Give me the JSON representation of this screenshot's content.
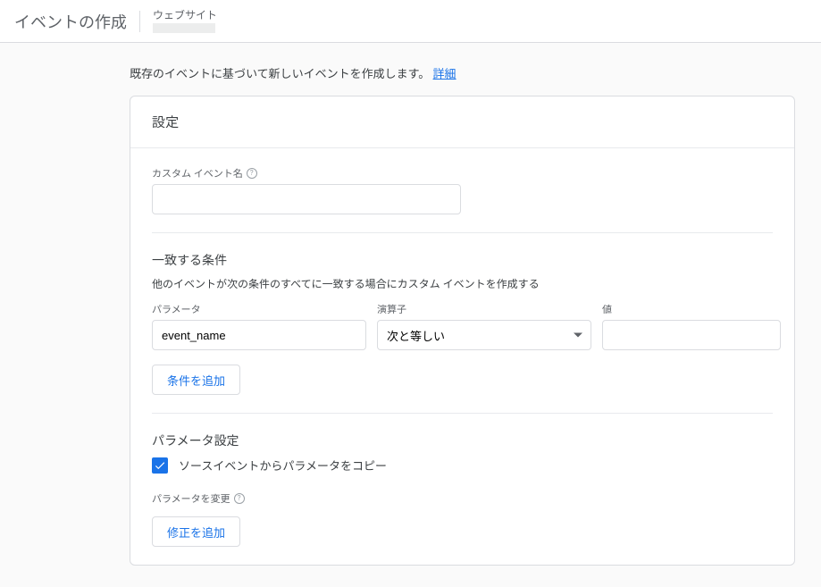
{
  "header": {
    "title": "イベントの作成",
    "subtitle": "ウェブサイト"
  },
  "intro": {
    "text": "既存のイベントに基づいて新しいイベントを作成します。",
    "link": "詳細"
  },
  "card": {
    "title": "設定",
    "custom_event": {
      "label": "カスタム イベント名",
      "value": ""
    },
    "conditions": {
      "title": "一致する条件",
      "desc": "他のイベントが次の条件のすべてに一致する場合にカスタム イベントを作成する",
      "labels": {
        "param": "パラメータ",
        "operator": "演算子",
        "value": "値"
      },
      "row": {
        "param": "event_name",
        "operator": "次と等しい",
        "value": ""
      },
      "add_button": "条件を追加"
    },
    "param_settings": {
      "title": "パラメータ設定",
      "copy_checked": true,
      "copy_label": "ソースイベントからパラメータをコピー",
      "modify_label": "パラメータを変更",
      "add_button": "修正を追加"
    }
  }
}
